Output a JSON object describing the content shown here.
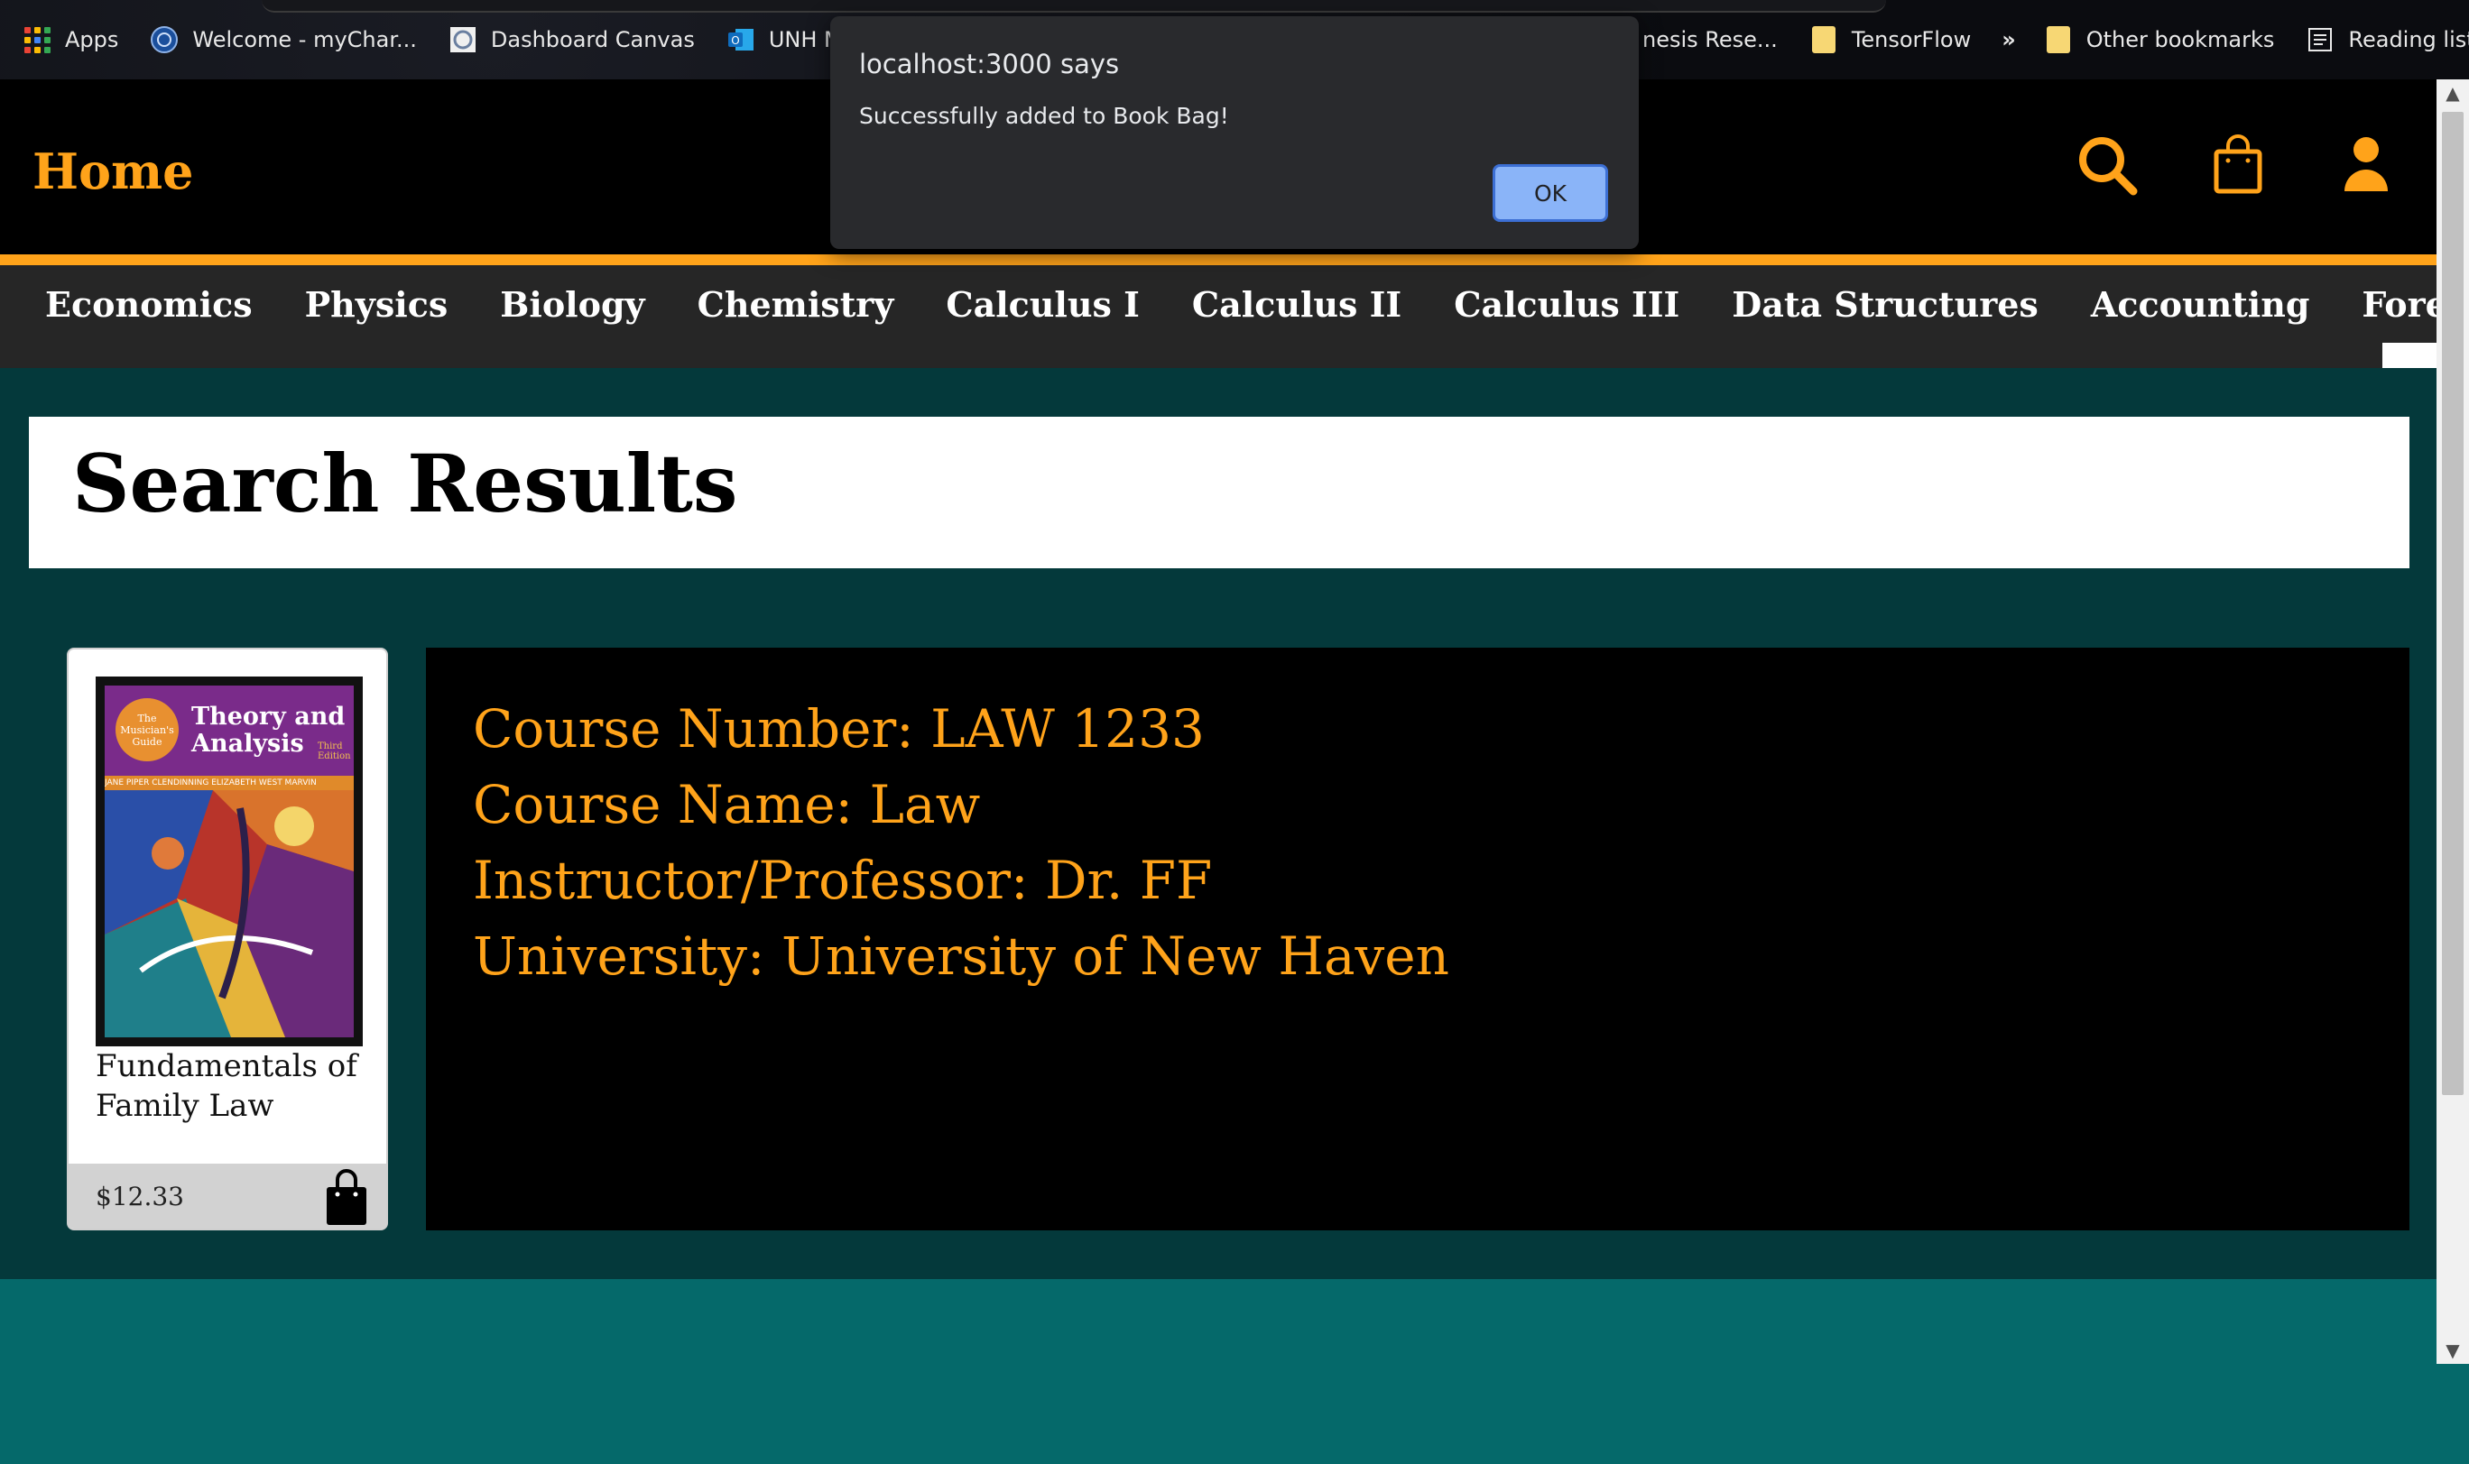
{
  "bookmarks": {
    "items": [
      {
        "label": "Apps",
        "icon": "apps-grid-icon"
      },
      {
        "label": "Welcome - myChar...",
        "icon": "globe-icon"
      },
      {
        "label": "Dashboard Canvas",
        "icon": "canvas-icon"
      },
      {
        "label": "UNH Mail - I",
        "icon": "outlook-icon"
      }
    ],
    "right_items": [
      {
        "label": "nesis Rese...",
        "icon": "bookmark-icon"
      },
      {
        "label": "TensorFlow",
        "icon": "folder-icon"
      }
    ],
    "overflow_label": "»",
    "other_bookmarks": "Other bookmarks",
    "reading_list": "Reading list"
  },
  "header": {
    "home_label": "Home",
    "accent_color": "#ffa31a",
    "icons": [
      "search-icon",
      "shopping-bag-icon",
      "user-icon"
    ]
  },
  "course_nav": {
    "items": [
      "Economics",
      "Physics",
      "Biology",
      "Chemistry",
      "Calculus I",
      "Calculus II",
      "Calculus III",
      "Data Structures",
      "Accounting",
      "Forensic Science"
    ]
  },
  "results": {
    "title": "Search Results"
  },
  "book": {
    "cover": {
      "badge": "The Musician's Guide",
      "title": "Theory and Analysis",
      "edition": "Third Edition",
      "authors": "JANE PIPER CLENDINNING  ELIZABETH WEST MARVIN"
    },
    "title": "Fundamentals of Family Law",
    "price": "$12.33"
  },
  "course_info": {
    "course_number": "Course Number: LAW 1233",
    "course_name": "Course Name: Law",
    "instructor": "Instructor/Professor: Dr. FF",
    "university": "University: University of New Haven"
  },
  "dialog": {
    "title": "localhost:3000 says",
    "message": "Successfully added to Book Bag!",
    "ok_label": "OK"
  }
}
